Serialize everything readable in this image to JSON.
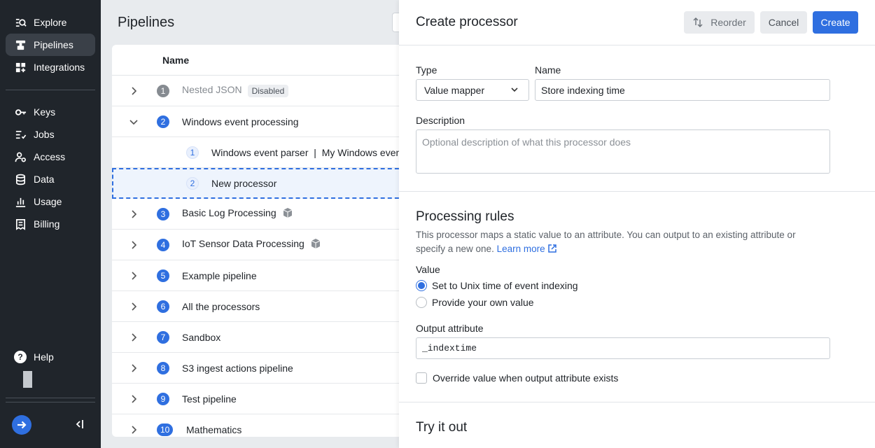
{
  "sidebar": {
    "items": [
      {
        "label": "Explore",
        "icon": "explore-icon"
      },
      {
        "label": "Pipelines",
        "icon": "pipelines-icon"
      },
      {
        "label": "Integrations",
        "icon": "integrations-icon"
      },
      {
        "label": "Keys",
        "icon": "key-icon"
      },
      {
        "label": "Jobs",
        "icon": "jobs-icon"
      },
      {
        "label": "Access",
        "icon": "access-icon"
      },
      {
        "label": "Data",
        "icon": "database-icon"
      },
      {
        "label": "Usage",
        "icon": "usage-icon"
      },
      {
        "label": "Billing",
        "icon": "billing-icon"
      }
    ],
    "help_label": "Help",
    "help_icon": "?"
  },
  "main": {
    "title": "Pipelines",
    "table_header": "Name",
    "rows": [
      {
        "num": "1",
        "name": "Nested JSON",
        "badge": "Disabled"
      },
      {
        "num": "2",
        "name": "Windows event processing"
      },
      {
        "num": "1",
        "name": "Windows event parser  |  My Windows event"
      },
      {
        "num": "2",
        "name": "New processor"
      },
      {
        "num": "3",
        "name": "Basic Log Processing"
      },
      {
        "num": "4",
        "name": "IoT Sensor Data Processing"
      },
      {
        "num": "5",
        "name": "Example pipeline"
      },
      {
        "num": "6",
        "name": "All the processors"
      },
      {
        "num": "7",
        "name": "Sandbox"
      },
      {
        "num": "8",
        "name": "S3 ingest actions pipeline"
      },
      {
        "num": "9",
        "name": "Test pipeline"
      },
      {
        "num": "10",
        "name": "Mathematics"
      }
    ]
  },
  "panel": {
    "title": "Create processor",
    "reorder_label": "Reorder",
    "cancel_label": "Cancel",
    "create_label": "Create",
    "type_label": "Type",
    "type_value": "Value mapper",
    "name_label": "Name",
    "name_value": "Store indexing time",
    "description_label": "Description",
    "description_placeholder": "Optional description of what this processor does",
    "rules_title": "Processing rules",
    "rules_help": "This processor maps a static value to an attribute. You can output to an existing attribute or specify a new one.",
    "learn_more": "Learn more",
    "value_label": "Value",
    "radio_options": [
      "Set to Unix time of event indexing",
      "Provide your own value"
    ],
    "output_label": "Output attribute",
    "output_value": "_indextime",
    "override_label": "Override value when output attribute exists",
    "try_title": "Try it out"
  },
  "colors": {
    "accent": "#2f6fe0",
    "sidebar_bg": "#20252b"
  }
}
